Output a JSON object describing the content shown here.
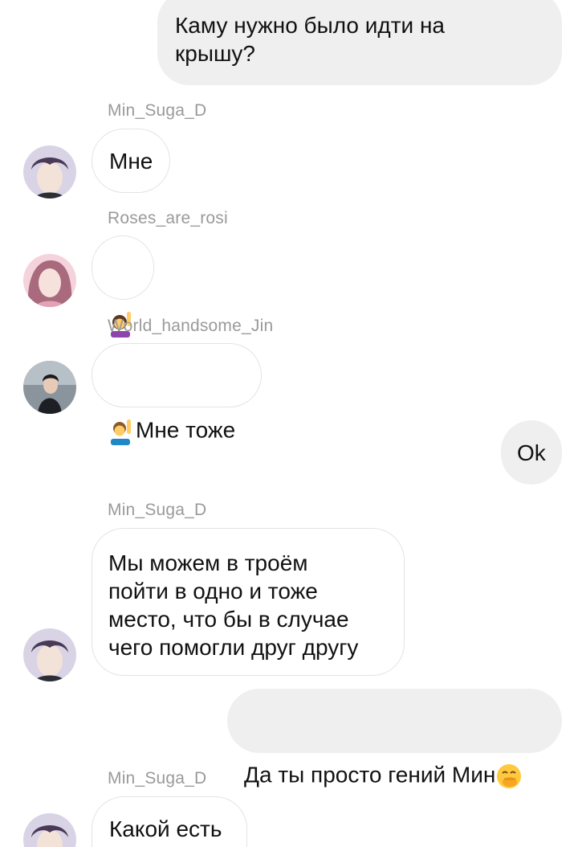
{
  "messages": {
    "m1": {
      "text": "Каму нужно было идти на\nкрышу?"
    },
    "m2": {
      "sender": "Min_Suga_D",
      "text": "Мне"
    },
    "m3": {
      "sender": "Roses_are_rosi",
      "emoji": "woman-raising-hand-emoji"
    },
    "m4": {
      "sender": "World_handsome_Jin",
      "emoji": "man-raising-hand-emoji",
      "text": "Мне тоже"
    },
    "m5": {
      "text": "Ok"
    },
    "m6": {
      "sender": "Min_Suga_D",
      "text": "Мы можем в троём\nпойти в одно и тоже\nместо, что бы в случае\nчего помогли друг другу"
    },
    "m7": {
      "text": "Да ты просто гений Мин",
      "emoji": "face-with-hand-over-mouth-emoji"
    },
    "m8": {
      "sender": "Min_Suga_D",
      "text": "Какой есть"
    }
  },
  "colors": {
    "outgoing_bubble": "#efefef",
    "incoming_border": "#e3e3e3",
    "sender_name": "#9a9a9a",
    "text": "#111111"
  }
}
